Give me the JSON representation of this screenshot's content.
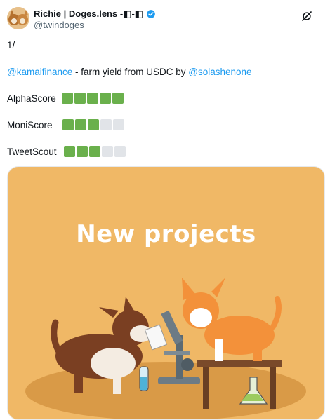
{
  "tweet": {
    "display_name": "Richie | Doges.lens -◧-◧",
    "handle": "@twindoges",
    "thread_marker": "1/",
    "line1": {
      "mention1": "@kamaifinance",
      "text": " - farm yield from USDC by ",
      "mention2": "@solashenone"
    },
    "scores": [
      {
        "label": "AlphaScore",
        "filled": 5,
        "total": 5
      },
      {
        "label": "MoniScore",
        "filled": 3,
        "total": 5
      },
      {
        "label": "TweetScout",
        "filled": 3,
        "total": 5
      }
    ],
    "media": {
      "title": "New projects"
    }
  },
  "icons": {
    "verified": "verified-badge-icon",
    "grok": "grok-icon"
  },
  "colors": {
    "link": "#1d9bf0",
    "score_on": "#6ab04c",
    "score_off": "#e1e4e8",
    "media_bg": "#f0b866"
  }
}
